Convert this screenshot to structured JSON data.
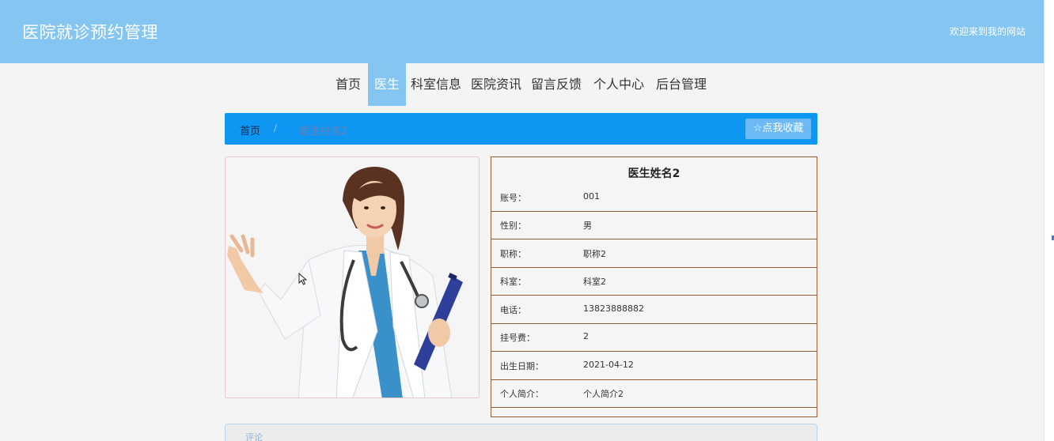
{
  "header": {
    "title": "医院就诊预约管理",
    "welcome": "欢迎来到我的网站"
  },
  "nav": {
    "items": [
      {
        "label": "首页",
        "active": false
      },
      {
        "label": "医生",
        "active": true
      },
      {
        "label": "科室信息",
        "active": false
      },
      {
        "label": "医院资讯",
        "active": false
      },
      {
        "label": "留言反馈",
        "active": false
      },
      {
        "label": "个人中心",
        "active": false
      },
      {
        "label": "后台管理",
        "active": false
      }
    ]
  },
  "breadcrumb": {
    "home": "首页",
    "separator": "/",
    "current": "医生姓名2"
  },
  "favorite": {
    "icon": "star-outline-icon",
    "label": "点我收藏"
  },
  "doctor": {
    "name": "医生姓名2",
    "fields": [
      {
        "label": "账号：",
        "value": "001"
      },
      {
        "label": "性别：",
        "value": "男"
      },
      {
        "label": "职称：",
        "value": "职称2"
      },
      {
        "label": "科室：",
        "value": "科室2"
      },
      {
        "label": "电话：",
        "value": "13823888882"
      },
      {
        "label": "挂号费：",
        "value": "2"
      },
      {
        "label": "出生日期：",
        "value": "2021-04-12"
      },
      {
        "label": "个人简介：",
        "value": "个人简介2"
      }
    ]
  },
  "comment": {
    "label": "评论"
  },
  "colors": {
    "header": "#84c5f2",
    "breadcrumb_bar": "#0d96f2",
    "favorite_button": "#6cbaf5",
    "info_border": "#9d5a36"
  }
}
